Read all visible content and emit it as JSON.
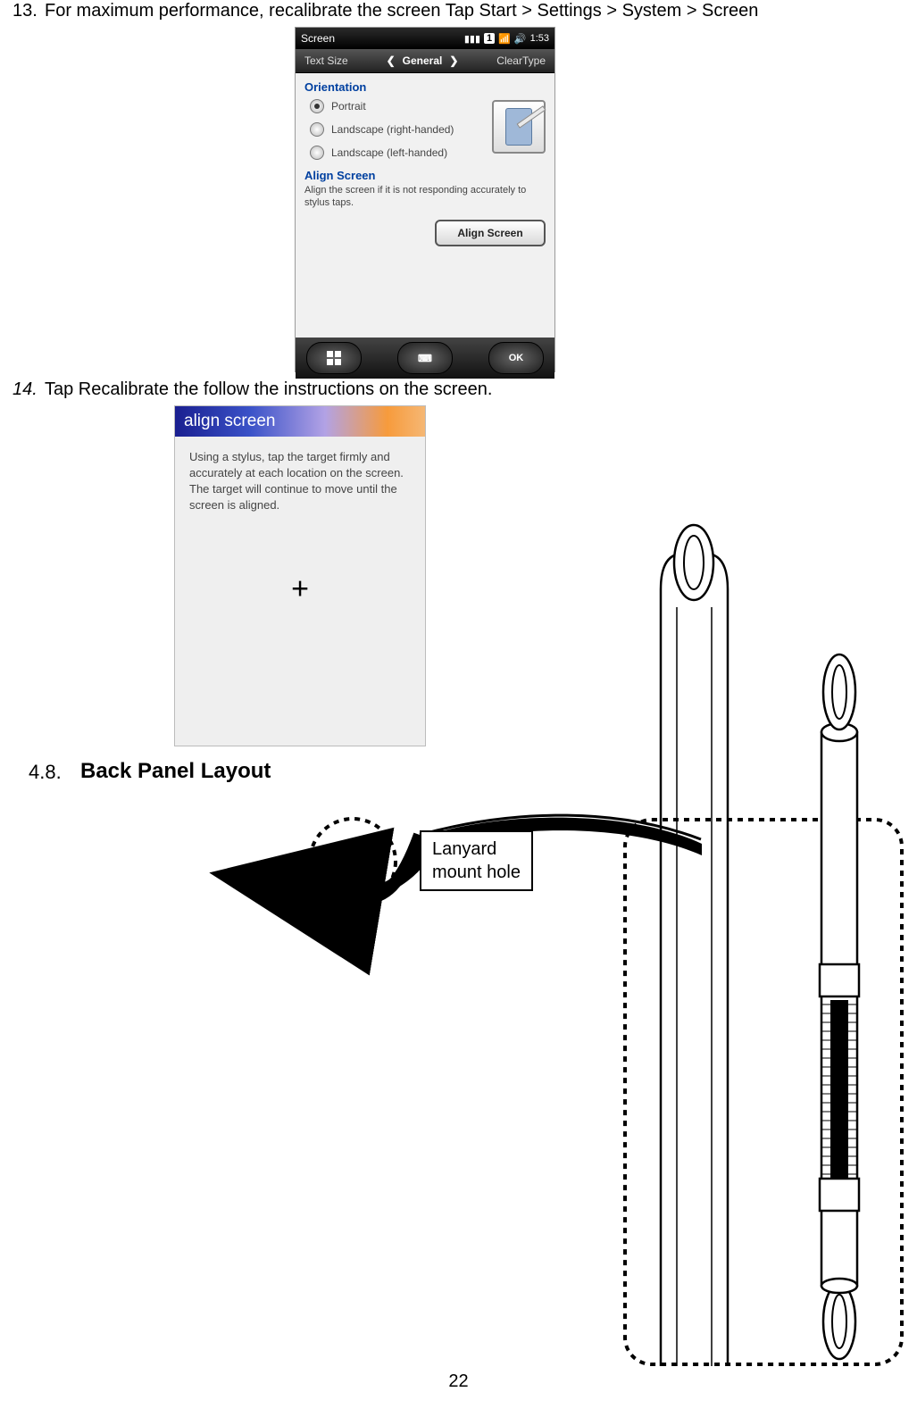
{
  "instructions": {
    "step13_num": "13.",
    "step13_text": "For maximum performance, recalibrate the screen Tap Start > Settings > System > Screen",
    "step14_num": "14.",
    "step14_text": "Tap Recalibrate the follow the instructions on the screen."
  },
  "section": {
    "number": "4.8.",
    "title": "Back Panel Layout"
  },
  "wm_screenshot": {
    "top_title": "Screen",
    "tray_number": "1",
    "time": "1:53",
    "tabs": {
      "left": "Text Size",
      "center": "General",
      "right": "ClearType"
    },
    "orientation_header": "Orientation",
    "radios": {
      "portrait": "Portrait",
      "landscape_right": "Landscape (right-handed)",
      "landscape_left": "Landscape (left-handed)"
    },
    "align_header": "Align Screen",
    "align_desc": "Align the screen if it is not responding accurately to stylus taps.",
    "align_button": "Align Screen",
    "bottom_ok": "OK"
  },
  "align_screenshot": {
    "title": "align screen",
    "text": "Using a stylus, tap the target firmly and accurately at each location on the screen. The target will continue to move until the screen is aligned.",
    "cross": "+"
  },
  "labels": {
    "lanyard_line1": "Lanyard",
    "lanyard_line2": "mount hole"
  },
  "page_number": "22"
}
